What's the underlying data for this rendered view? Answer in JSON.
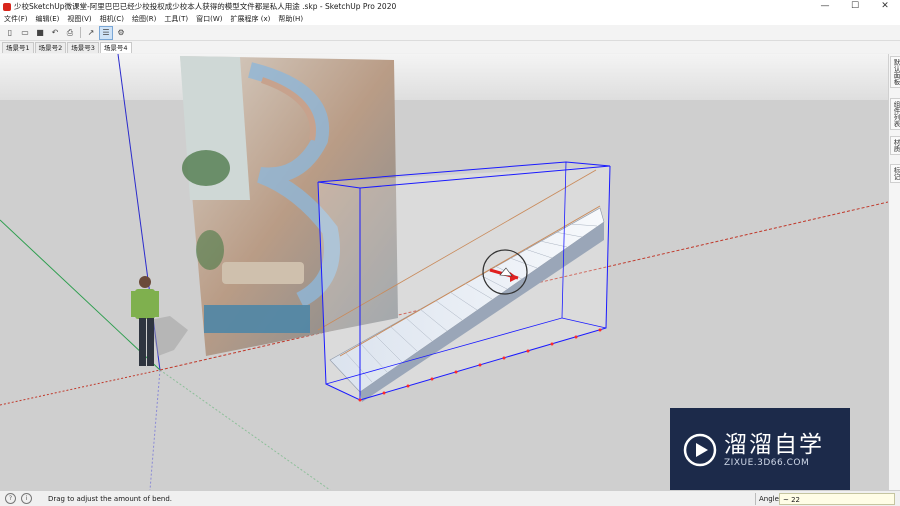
{
  "window": {
    "title": "少校SketchUp微课堂-阿里巴巴已经少校投权成少校本人获得的模型文件都是私人用途 .skp - SketchUp Pro 2020",
    "minimize": "—",
    "maximize": "☐",
    "close": "✕"
  },
  "menu": [
    "文件(F)",
    "编辑(E)",
    "视图(V)",
    "相机(C)",
    "绘图(R)",
    "工具(T)",
    "窗口(W)",
    "扩展程序 (x)",
    "帮助(H)"
  ],
  "toolbar": {
    "icons": [
      "new-file-icon",
      "open-file-icon",
      "save-icon",
      "undo-icon",
      "print-icon",
      "select-icon",
      "outliner-icon",
      "settings-icon"
    ]
  },
  "scenes": {
    "tabs": [
      "场景号1",
      "场景号2",
      "场景号3",
      "场景号4"
    ],
    "active": 3
  },
  "side_panel": {
    "tabs": [
      "默认面板",
      "组件列表",
      "材质",
      "标记"
    ]
  },
  "status": {
    "hint": "Drag to adjust the amount of bend.",
    "vcb_label": "Angle",
    "vcb_value": "~ 22"
  },
  "watermark": {
    "title": "溜溜自学",
    "url": "ZIXUE.3D66.COM"
  },
  "colors": {
    "sky": "#e8e8e8",
    "ground": "#cfcfcf",
    "selection": "#1a1aff",
    "axis_red": "#c0392b",
    "axis_green": "#2e9e4f",
    "axis_blue": "#2b2bcc",
    "watermark_bg": "#1c2a4a"
  }
}
